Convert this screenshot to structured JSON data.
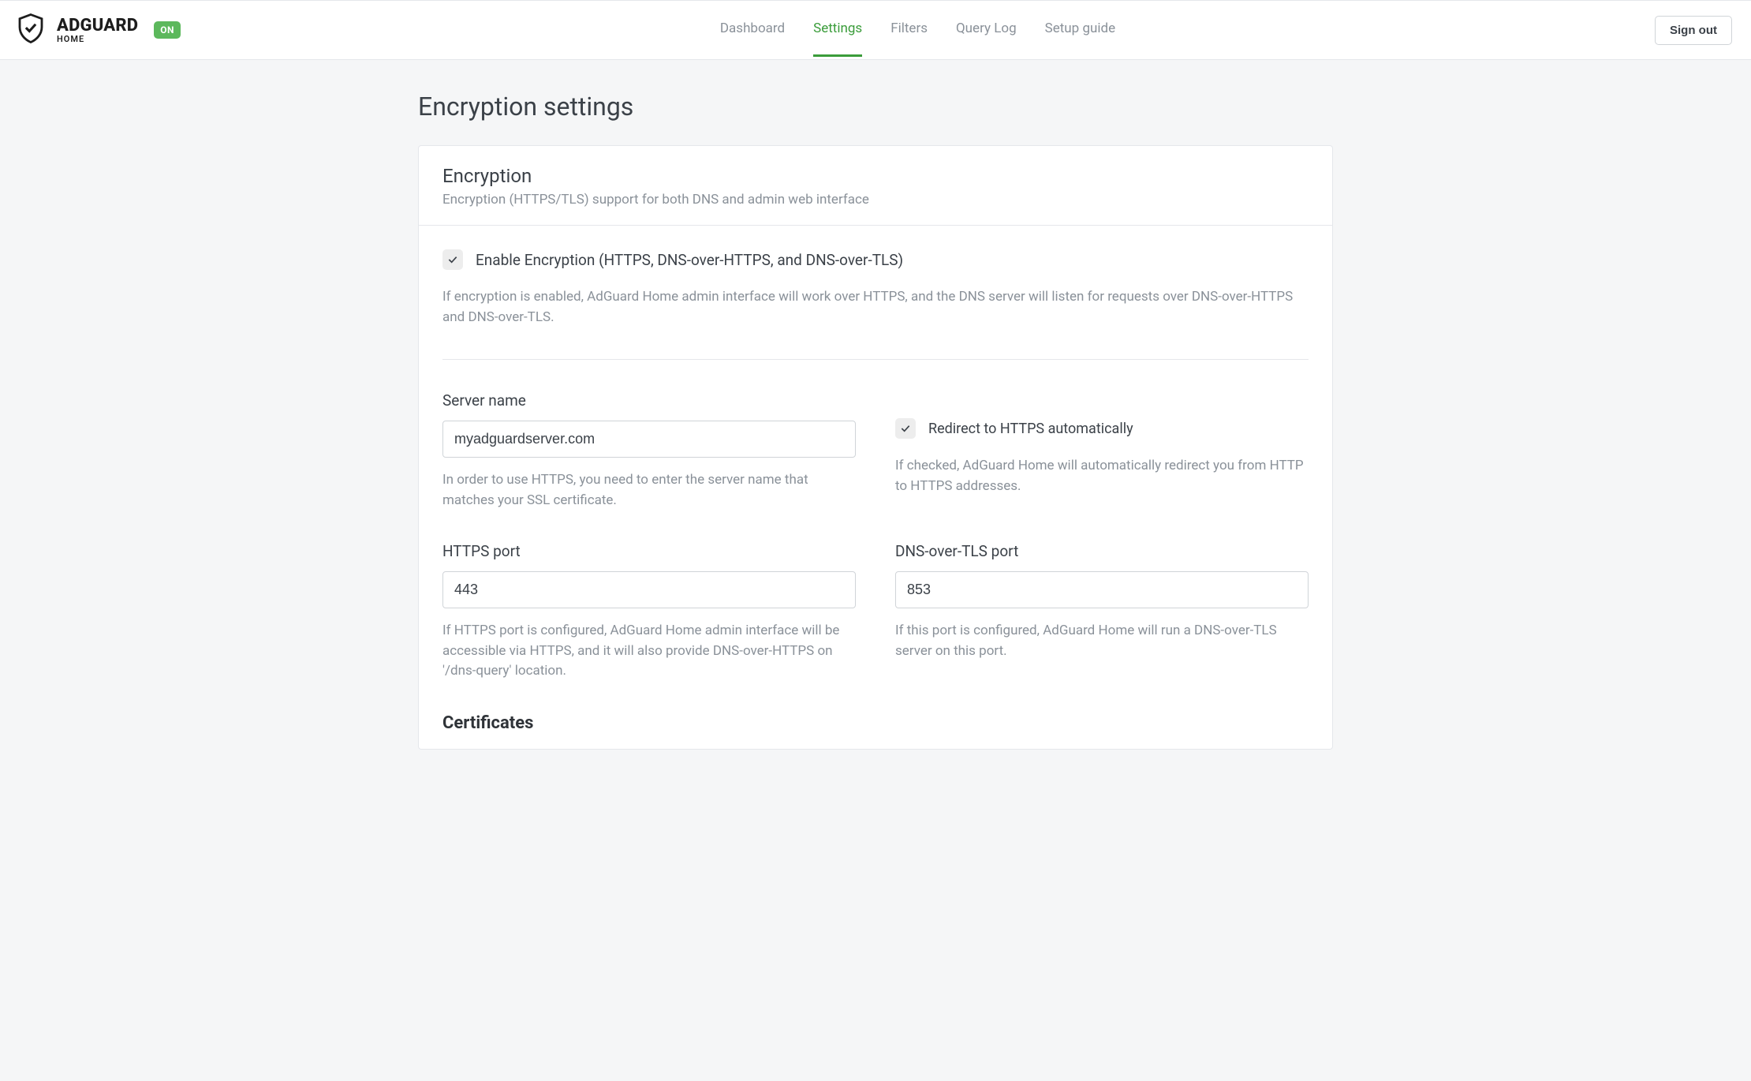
{
  "brand": {
    "main": "ADGUARD",
    "sub": "HOME",
    "badge": "ON"
  },
  "nav": {
    "dashboard": "Dashboard",
    "settings": "Settings",
    "filters": "Filters",
    "querylog": "Query Log",
    "setupguide": "Setup guide"
  },
  "signout": "Sign out",
  "page_title": "Encryption settings",
  "card": {
    "title": "Encryption",
    "subtitle": "Encryption (HTTPS/TLS) support for both DNS and admin web interface"
  },
  "enable": {
    "label": "Enable Encryption (HTTPS, DNS-over-HTTPS, and DNS-over-TLS)",
    "help": "If encryption is enabled, AdGuard Home admin interface will work over HTTPS, and the DNS server will listen for requests over DNS-over-HTTPS and DNS-over-TLS."
  },
  "server_name": {
    "label": "Server name",
    "value": "myadguardserver.com",
    "help": "In order to use HTTPS, you need to enter the server name that matches your SSL certificate."
  },
  "redirect": {
    "label": "Redirect to HTTPS automatically",
    "help": "If checked, AdGuard Home will automatically redirect you from HTTP to HTTPS addresses."
  },
  "https_port": {
    "label": "HTTPS port",
    "value": "443",
    "help": "If HTTPS port is configured, AdGuard Home admin interface will be accessible via HTTPS, and it will also provide DNS-over-HTTPS on '/dns-query' location."
  },
  "tls_port": {
    "label": "DNS-over-TLS port",
    "value": "853",
    "help": "If this port is configured, AdGuard Home will run a DNS-over-TLS server on this port."
  },
  "certificates_heading": "Certificates"
}
